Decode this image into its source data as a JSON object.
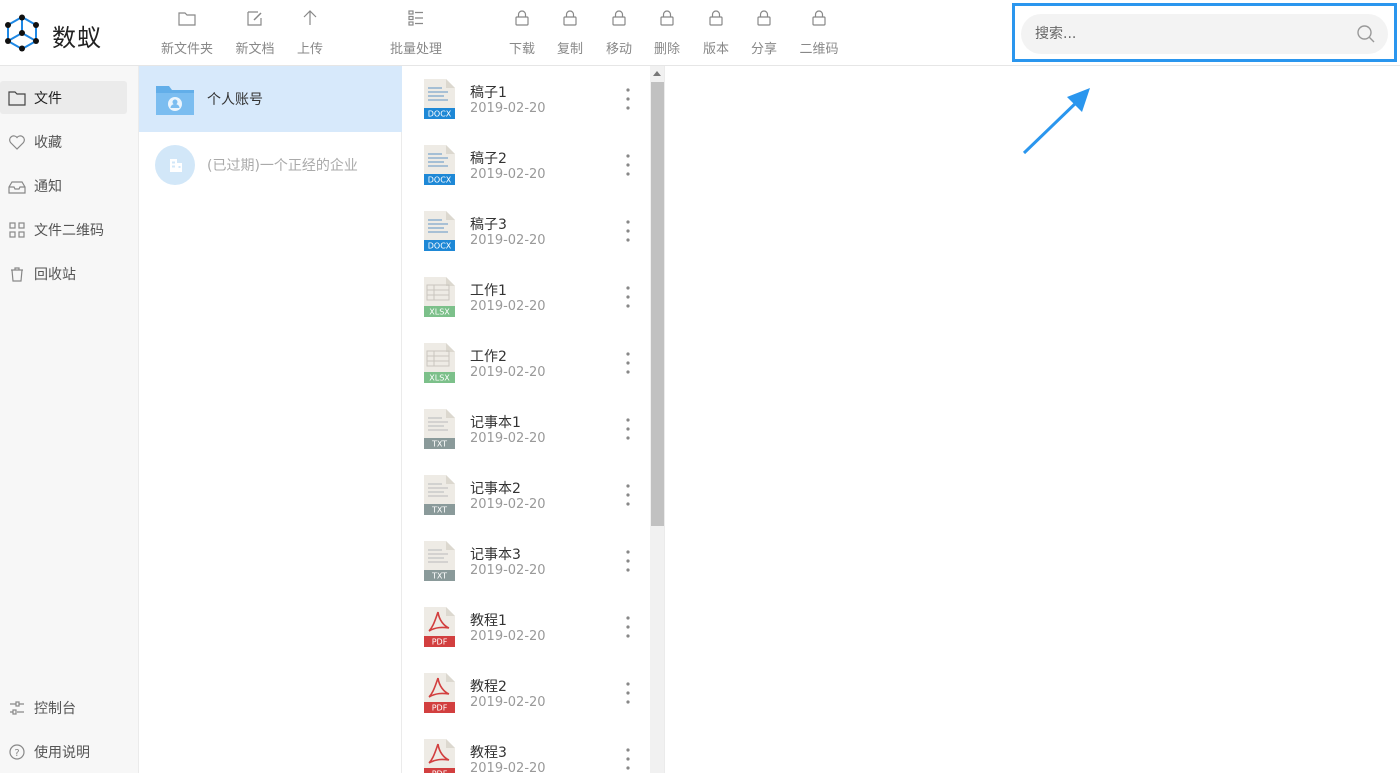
{
  "app": {
    "name": "数蚁"
  },
  "toolbar": [
    {
      "id": "new-folder",
      "label": "新文件夹",
      "icon": "folder-icon"
    },
    {
      "id": "new-doc",
      "label": "新文档",
      "icon": "edit-icon"
    },
    {
      "id": "upload",
      "label": "上传",
      "icon": "upload-icon"
    },
    {
      "id": "batch",
      "label": "批量处理",
      "icon": "batch-icon"
    },
    {
      "id": "download",
      "label": "下载",
      "icon": "lock-icon"
    },
    {
      "id": "copy",
      "label": "复制",
      "icon": "lock-icon"
    },
    {
      "id": "move",
      "label": "移动",
      "icon": "lock-icon"
    },
    {
      "id": "delete",
      "label": "删除",
      "icon": "lock-icon"
    },
    {
      "id": "version",
      "label": "版本",
      "icon": "lock-icon"
    },
    {
      "id": "share",
      "label": "分享",
      "icon": "lock-icon"
    },
    {
      "id": "qrcode",
      "label": "二维码",
      "icon": "lock-icon"
    }
  ],
  "search": {
    "placeholder": "搜索..."
  },
  "nav": {
    "items": [
      {
        "label": "文件",
        "icon": "file-icon"
      },
      {
        "label": "收藏",
        "icon": "heart-icon"
      },
      {
        "label": "通知",
        "icon": "inbox-icon"
      },
      {
        "label": "文件二维码",
        "icon": "qrcode-icon"
      },
      {
        "label": "回收站",
        "icon": "trash-icon"
      }
    ],
    "bottom": [
      {
        "label": "控制台",
        "icon": "console-icon"
      },
      {
        "label": "使用说明",
        "icon": "help-icon"
      }
    ]
  },
  "accounts": [
    {
      "label": "个人账号",
      "icon": "user-folder-icon"
    },
    {
      "label": "(已过期)一个正经的企业",
      "icon": "enterprise-icon"
    }
  ],
  "files": [
    {
      "name": "稿子1",
      "date": "2019-02-20",
      "type": "DOCX"
    },
    {
      "name": "稿子2",
      "date": "2019-02-20",
      "type": "DOCX"
    },
    {
      "name": "稿子3",
      "date": "2019-02-20",
      "type": "DOCX"
    },
    {
      "name": "工作1",
      "date": "2019-02-20",
      "type": "XLSX"
    },
    {
      "name": "工作2",
      "date": "2019-02-20",
      "type": "XLSX"
    },
    {
      "name": "记事本1",
      "date": "2019-02-20",
      "type": "TXT"
    },
    {
      "name": "记事本2",
      "date": "2019-02-20",
      "type": "TXT"
    },
    {
      "name": "记事本3",
      "date": "2019-02-20",
      "type": "TXT"
    },
    {
      "name": "教程1",
      "date": "2019-02-20",
      "type": "PDF"
    },
    {
      "name": "教程2",
      "date": "2019-02-20",
      "type": "PDF"
    },
    {
      "name": "教程3",
      "date": "2019-02-20",
      "type": "PDF"
    }
  ],
  "colors": {
    "accent": "#2a96ee",
    "docx": "#1e88d6",
    "xlsx": "#7cc08a",
    "txt": "#8a9a9a",
    "pdf": "#d23f3f"
  }
}
